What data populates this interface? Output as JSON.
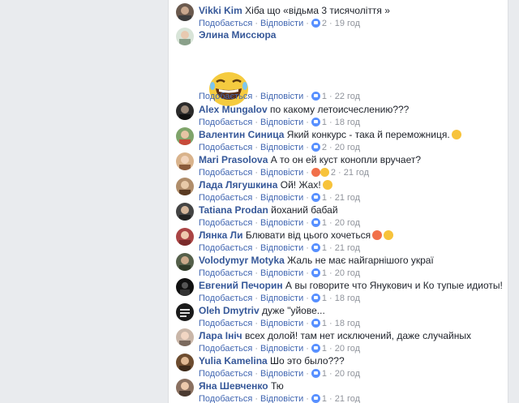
{
  "ui": {
    "like": "Подобається",
    "reply": "Відповісти"
  },
  "comments": [
    {
      "author": "Vikki Kim",
      "text": "Хіба що «відьма 3 тисячоліття »",
      "count": "2",
      "time": "19 год"
    },
    {
      "author": "Элина Миссюра",
      "text": "",
      "count": "1",
      "time": "22 год"
    },
    {
      "author": "Alex Mungalov",
      "text": "по какому летоисчеслению???",
      "count": "1",
      "time": "18 год"
    },
    {
      "author": "Валентин Синица",
      "text": "Який конкурс - така й переможниця.",
      "count": "2",
      "time": "20 год"
    },
    {
      "author": "Mari Prasolova",
      "text": "А то он ей куст конопли вручает?",
      "count": "2",
      "time": "21 год"
    },
    {
      "author": "Лада Лягушкина",
      "text": "Ой! Жах!",
      "count": "1",
      "time": "21 год"
    },
    {
      "author": "Tatiana Prodan",
      "text": "йоханий бабай",
      "count": "1",
      "time": "20 год"
    },
    {
      "author": "Лянка Ли",
      "text": "Блювати від цього хочеться",
      "count": "1",
      "time": "21 год"
    },
    {
      "author": "Volodymyr Motyka",
      "text": "Жаль не має найгарнішого украї",
      "count": "1",
      "time": "20 год"
    },
    {
      "author": "Евгений Печорин",
      "text": "А вы говорите что Янукович и Ко тупые идиоты!",
      "count": "1",
      "time": "18 год"
    },
    {
      "author": "Oleh Dmytriv",
      "text": "дуже \"уйове...",
      "count": "1",
      "time": "18 год"
    },
    {
      "author": "Лара Iніч",
      "text": "всех долой! там нет исключений, даже случайных",
      "count": "1",
      "time": "20 год"
    },
    {
      "author": "Yulia Kamelina",
      "text": "Шо это было???",
      "count": "1",
      "time": "20 год"
    },
    {
      "author": "Яна Шевченко",
      "text": "Тю",
      "count": "1",
      "time": "21 год"
    }
  ],
  "colors": {
    "author": "#365899",
    "link": "#4267b2",
    "meta": "#90949c",
    "like": "#5890ff",
    "haha": "#f7c33b",
    "angry": "#f1704a"
  }
}
